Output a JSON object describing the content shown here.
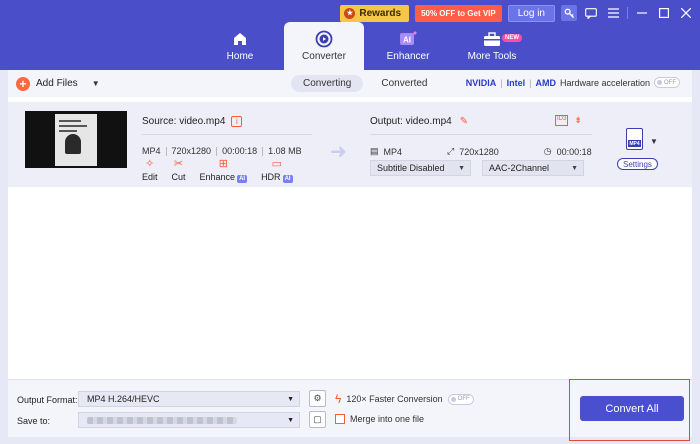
{
  "header": {
    "rewards_label": "Rewards",
    "vip_label": "50% OFF to Get VIP",
    "login_label": "Log in",
    "tabs": [
      {
        "label": "Home",
        "icon": "home-icon"
      },
      {
        "label": "Converter",
        "icon": "converter-icon",
        "active": true
      },
      {
        "label": "Enhancer",
        "icon": "ai-enhancer-icon"
      },
      {
        "label": "More Tools",
        "icon": "toolbox-icon",
        "badge": "NEW"
      }
    ]
  },
  "toolbar": {
    "add_files_label": "Add Files",
    "subtabs": [
      "Converting",
      "Converted"
    ],
    "hw_nvidia": "NVIDIA",
    "hw_intel": "Intel",
    "hw_amd": "AMD",
    "hw_label": "Hardware acceleration",
    "hw_toggle": "OFF"
  },
  "file": {
    "source_label": "Source: video.mp4",
    "src_format": "MP4",
    "src_resolution": "720x1280",
    "src_duration": "00:00:18",
    "src_size": "1.08 MB",
    "tools": [
      {
        "label": "Edit",
        "icon": "magic-wand-icon"
      },
      {
        "label": "Cut",
        "icon": "scissors-icon"
      },
      {
        "label": "Enhance",
        "icon": "enhance-icon",
        "ai": "AI"
      },
      {
        "label": "HDR",
        "icon": "hdr-icon",
        "ai": "AI"
      }
    ],
    "output_label": "Output: video.mp4",
    "out_format": "MP4",
    "out_resolution": "720x1280",
    "out_duration": "00:00:18",
    "subtitle": "Subtitle Disabled",
    "audio": "AAC-2Channel",
    "format_badge": "MP4",
    "settings_label": "Settings"
  },
  "bottom": {
    "output_format_label": "Output Format:",
    "output_format_value": "MP4 H.264/HEVC",
    "save_to_label": "Save to:",
    "faster_label": "120× Faster Conversion",
    "faster_toggle": "OFF",
    "merge_label": "Merge into one file",
    "convert_label": "Convert All"
  },
  "colors": {
    "header": "#4a4fc9",
    "accent": "#ff5a36",
    "primary_button": "#4a4fd0"
  }
}
